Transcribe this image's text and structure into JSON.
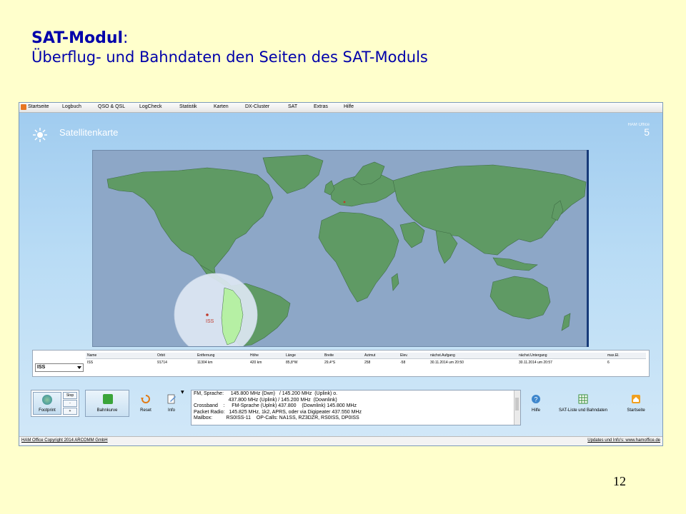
{
  "slide": {
    "title_bold": "SAT-Modul",
    "title_colon": ":",
    "subtitle": "Überflug- und Bahndaten den Seiten des SAT-Moduls",
    "page_number": "12"
  },
  "app": {
    "menu": [
      "Startseite",
      "Logbuch",
      "QSO & QSL",
      "LogCheck",
      "Statistik",
      "Karten",
      "DX-Cluster",
      "SAT",
      "Extras",
      "Hilfe"
    ],
    "page_title": "Satellitenkarte",
    "brand_name": "HAM Office",
    "brand_version": "5",
    "map": {
      "satellite_label": "ISS",
      "colors": {
        "ocean": "#8da7c7",
        "land": "#5f9a64",
        "border": "#3f6d45",
        "footprint": "#dde7f3",
        "footprint_land": "#b6f0a4",
        "marker": "#c0392b"
      }
    },
    "sat_select": "ISS",
    "table": {
      "headers": [
        "Name",
        "Orbit",
        "Entfernung",
        "Höhe",
        "Länge",
        "Breite",
        "Azimut",
        "Elev.",
        "nächst.Aufgang",
        "nächst.Untergang",
        "max.El."
      ],
      "row": [
        "ISS",
        "91714",
        "11304 km",
        "420 km",
        "85,8°W",
        "29,4°S",
        "258",
        "-58",
        "30.11.2014 um 20:50",
        "30.11.2014 um 20:57",
        "6"
      ]
    },
    "toolbar": {
      "footprint": "Footprint",
      "stop": "Stop",
      "minus": "-",
      "plus": "+",
      "bahnkurve": "Bahnkurve",
      "reset": "Reset",
      "info": "Info",
      "hilfe": "Hilfe",
      "sat_liste": "SAT-Liste und Bahndaten",
      "startseite": "Startseite"
    },
    "info_lines": [
      "FM, Sprache:     145.800 MHz (Dwn)   / 145.200 MHz  (Uplink) o.",
      "                         437.800 MHz (Uplink) / 145.200 MHz  (Downlink)",
      "Crossband    :     FM-Sprache (Uplnk) 437.800    (Downlink) 145.800 MHz",
      "Packet Radio:   145.825 MHz, 1k2, APRS, oder via Digipeater 437.550 MHz",
      "Mailbox:          RS0ISS-11    OP-Calls: NA1SS, RZ3DZR, RS0ISS, DP0ISS"
    ],
    "status_left": "HAM Office Copyright 2014 ARCOMM GmbH",
    "status_right": "Updates und Info's: www.hamoffice.de"
  }
}
